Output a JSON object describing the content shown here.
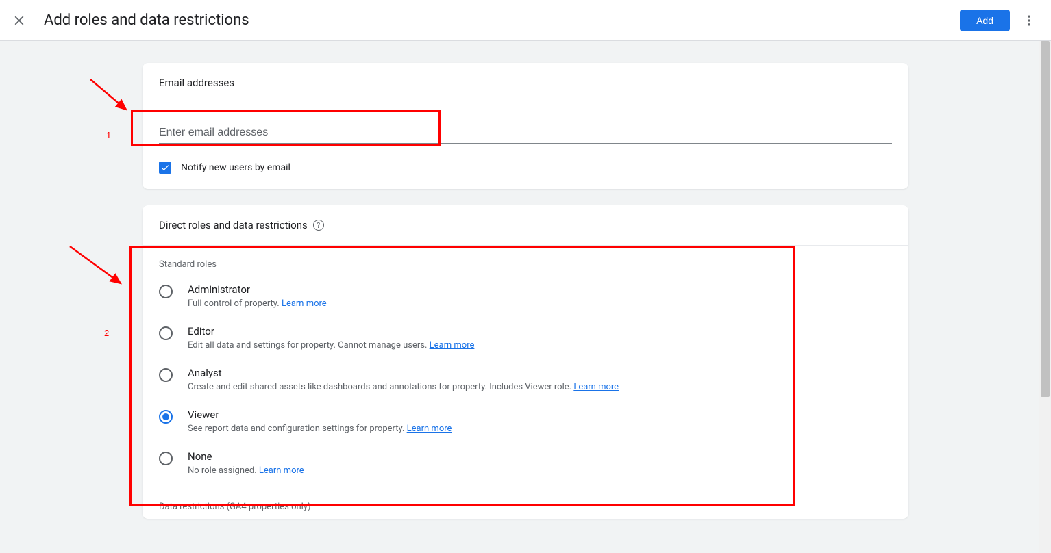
{
  "header": {
    "title": "Add roles and data restrictions",
    "add_label": "Add"
  },
  "email_section": {
    "header": "Email addresses",
    "placeholder": "Enter email addresses",
    "notify_label": "Notify new users by email"
  },
  "roles_section": {
    "header": "Direct roles and data restrictions",
    "standard_label": "Standard roles",
    "learn_more": "Learn more",
    "roles": [
      {
        "name": "Administrator",
        "desc": "Full control of property. ",
        "selected": false
      },
      {
        "name": "Editor",
        "desc": "Edit all data and settings for property. Cannot manage users. ",
        "selected": false
      },
      {
        "name": "Analyst",
        "desc": "Create and edit shared assets like dashboards and annotations for property. Includes Viewer role. ",
        "selected": false
      },
      {
        "name": "Viewer",
        "desc": "See report data and configuration settings for property. ",
        "selected": true
      },
      {
        "name": "None",
        "desc": "No role assigned. ",
        "selected": false
      }
    ],
    "data_restrictions_label": "Data restrictions (GA4 properties only)"
  },
  "annotations": {
    "num1": "1",
    "num2": "2"
  }
}
